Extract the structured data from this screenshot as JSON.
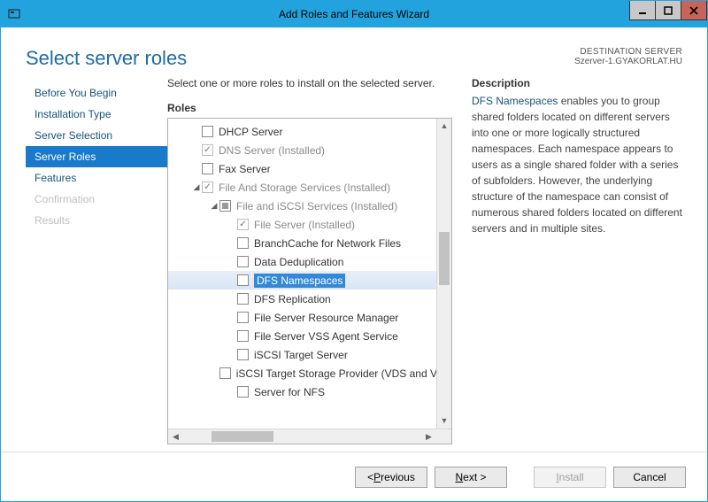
{
  "window_title": "Add Roles and Features Wizard",
  "page_title": "Select server roles",
  "destination": {
    "label": "DESTINATION SERVER",
    "value": "Szerver-1.GYAKORLAT.HU"
  },
  "nav": [
    {
      "label": "Before You Begin",
      "state": ""
    },
    {
      "label": "Installation Type",
      "state": ""
    },
    {
      "label": "Server Selection",
      "state": ""
    },
    {
      "label": "Server Roles",
      "state": "active"
    },
    {
      "label": "Features",
      "state": ""
    },
    {
      "label": "Confirmation",
      "state": "disabled"
    },
    {
      "label": "Results",
      "state": "disabled"
    }
  ],
  "instruction": "Select one or more roles to install on the selected server.",
  "roles_label": "Roles",
  "description_label": "Description",
  "roles": [
    {
      "indent": 0,
      "tri": "",
      "chk": "unchecked",
      "label": "DHCP Server",
      "dim": false,
      "selected": false
    },
    {
      "indent": 0,
      "tri": "",
      "chk": "checked-disabled",
      "label": "DNS Server (Installed)",
      "dim": true,
      "selected": false
    },
    {
      "indent": 0,
      "tri": "",
      "chk": "unchecked",
      "label": "Fax Server",
      "dim": false,
      "selected": false
    },
    {
      "indent": 0,
      "tri": "open",
      "chk": "checked-disabled",
      "label": "File And Storage Services (Installed)",
      "dim": true,
      "selected": false
    },
    {
      "indent": 1,
      "tri": "open",
      "chk": "indeterminate",
      "label": "File and iSCSI Services (Installed)",
      "dim": true,
      "selected": false
    },
    {
      "indent": 2,
      "tri": "",
      "chk": "checked-disabled",
      "label": "File Server (Installed)",
      "dim": true,
      "selected": false
    },
    {
      "indent": 2,
      "tri": "",
      "chk": "unchecked",
      "label": "BranchCache for Network Files",
      "dim": false,
      "selected": false
    },
    {
      "indent": 2,
      "tri": "",
      "chk": "unchecked",
      "label": "Data Deduplication",
      "dim": false,
      "selected": false
    },
    {
      "indent": 2,
      "tri": "",
      "chk": "unchecked",
      "label": "DFS Namespaces",
      "dim": false,
      "selected": true
    },
    {
      "indent": 2,
      "tri": "",
      "chk": "unchecked",
      "label": "DFS Replication",
      "dim": false,
      "selected": false
    },
    {
      "indent": 2,
      "tri": "",
      "chk": "unchecked",
      "label": "File Server Resource Manager",
      "dim": false,
      "selected": false
    },
    {
      "indent": 2,
      "tri": "",
      "chk": "unchecked",
      "label": "File Server VSS Agent Service",
      "dim": false,
      "selected": false
    },
    {
      "indent": 2,
      "tri": "",
      "chk": "unchecked",
      "label": "iSCSI Target Server",
      "dim": false,
      "selected": false
    },
    {
      "indent": 2,
      "tri": "",
      "chk": "unchecked",
      "label": "iSCSI Target Storage Provider (VDS and VSS",
      "dim": false,
      "selected": false
    },
    {
      "indent": 2,
      "tri": "",
      "chk": "unchecked",
      "label": "Server for NFS",
      "dim": false,
      "selected": false
    }
  ],
  "description": {
    "lead": "DFS Namespaces",
    "body": " enables you to group shared folders located on different servers into one or more logically structured namespaces. Each namespace appears to users as a single shared folder with a series of subfolders. However, the underlying structure of the namespace can consist of numerous shared folders located on different servers and in multiple sites."
  },
  "buttons": {
    "previous": "Previous",
    "next": "Next >",
    "install": "Install",
    "cancel": "Cancel"
  }
}
